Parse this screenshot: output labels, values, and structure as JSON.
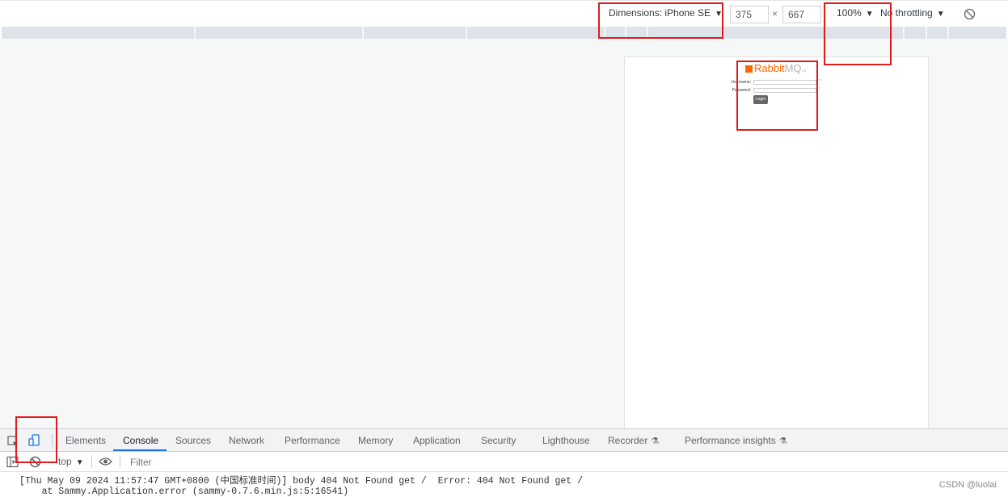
{
  "device_toolbar": {
    "dimensions_label": "Dimensions: iPhone SE",
    "width": "375",
    "height": "667",
    "times": "×",
    "zoom": "100%",
    "throttling": "No throttling",
    "rotate_icon": "rotate-icon"
  },
  "rendered_page": {
    "logo_rabbit": "Rabbit",
    "logo_mq": "MQ",
    "logo_tm": "TM",
    "username_label": "Username:",
    "password_label": "Password:",
    "required_mark": "*",
    "login_button": "Login"
  },
  "devtools": {
    "tabs": [
      "Elements",
      "Console",
      "Sources",
      "Network",
      "Performance",
      "Memory",
      "Application",
      "Security",
      "Lighthouse",
      "Recorder",
      "Performance insights"
    ],
    "active_tab": "Console",
    "context": "top",
    "filter_placeholder": "Filter"
  },
  "console": {
    "line1": "[Thu May 09 2024 11:57:47 GMT+0800 (中国标准时间)] body 404 Not Found get /  Error: 404 Not Found get /",
    "line2": "    at Sammy.Application.error (sammy-0.7.6.min.js:5:16541)"
  },
  "watermark": "CSDN @luolai",
  "colors": {
    "accent": "#1a73e8",
    "annotation": "#e01b1b",
    "rabbitmq": "#ff6600"
  }
}
